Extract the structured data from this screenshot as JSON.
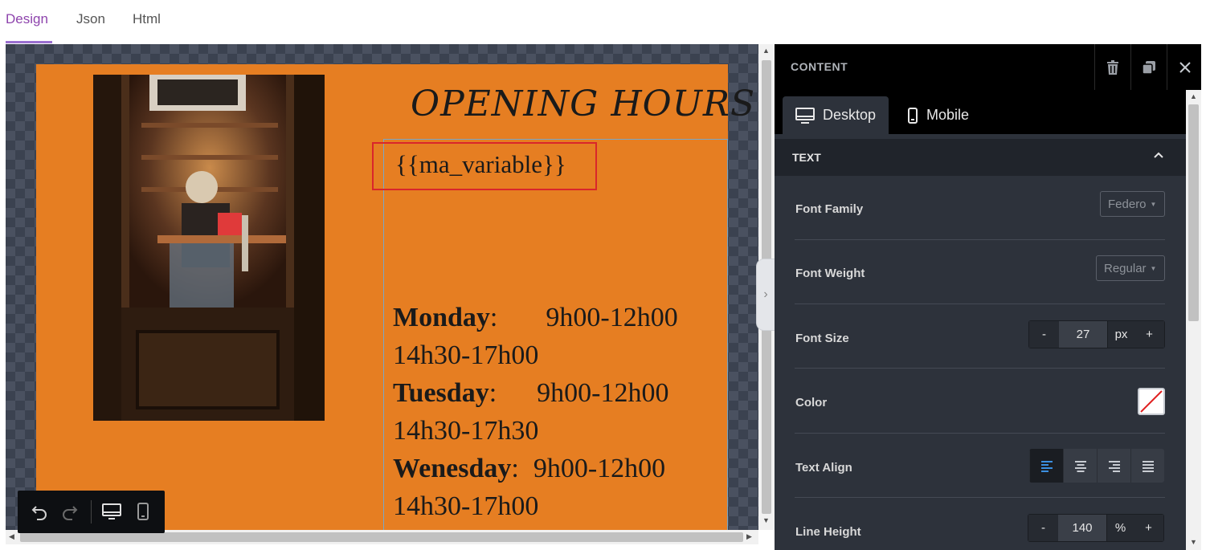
{
  "top_tabs": [
    {
      "label": "Design",
      "active": true
    },
    {
      "label": "Json",
      "active": false
    },
    {
      "label": "Html",
      "active": false
    }
  ],
  "canvas": {
    "title": "OPENING HOURS",
    "variable": "{{ma_variable}}",
    "hours": [
      {
        "day": "Monday",
        "sep": ":",
        "am": "9h00-12h00",
        "pm": "14h30-17h00"
      },
      {
        "day": "Tuesday",
        "sep": ":",
        "am": "9h00-12h00",
        "pm": "14h30-17h30"
      },
      {
        "day": "Wenesday",
        "sep": ":",
        "am": "9h00-12h00",
        "pm": "14h30-17h00"
      }
    ],
    "background_color": "#e67e22"
  },
  "toolbar": {
    "undo_icon": "undo-icon",
    "redo_icon": "redo-icon",
    "desktop_icon": "desktop-icon",
    "mobile_icon": "mobile-icon"
  },
  "panel": {
    "title": "CONTENT",
    "device_tabs": [
      {
        "label": "Desktop",
        "active": true
      },
      {
        "label": "Mobile",
        "active": false
      }
    ],
    "section_title": "TEXT",
    "font_family": {
      "label": "Font Family",
      "value": "Federo"
    },
    "font_weight": {
      "label": "Font Weight",
      "value": "Regular"
    },
    "font_size": {
      "label": "Font Size",
      "minus": "-",
      "value": "27",
      "unit": "px",
      "plus": "+"
    },
    "color": {
      "label": "Color"
    },
    "text_align": {
      "label": "Text Align",
      "options": [
        "left",
        "center",
        "right",
        "justify"
      ],
      "selected": "left"
    },
    "line_height": {
      "label": "Line Height",
      "minus": "-",
      "value": "140",
      "unit": "%",
      "plus": "+"
    },
    "accent_color": "#8e44ad"
  }
}
